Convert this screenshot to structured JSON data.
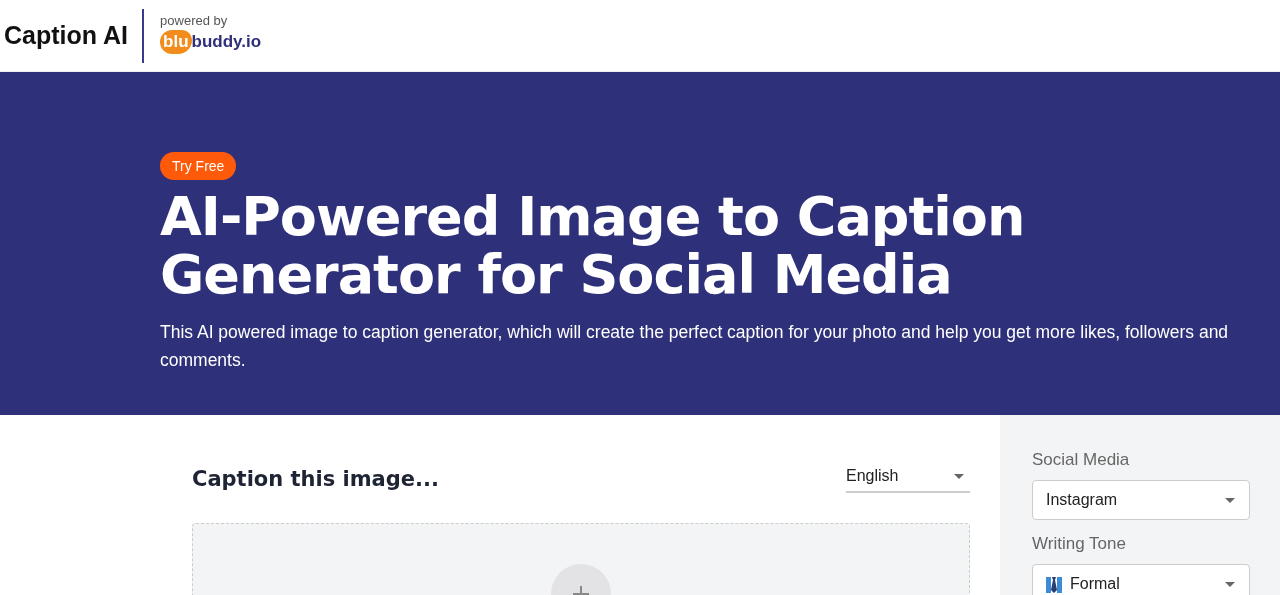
{
  "header": {
    "brand": "Caption AI",
    "powered_by": "powered by",
    "partner_logo": {
      "part_1": "blu",
      "part_2": "buddy.io"
    }
  },
  "hero": {
    "badge": "Try Free",
    "title": "AI-Powered Image to Caption Generator for Social Media",
    "description": "This AI powered image to caption generator, which will create the perfect caption for your photo and help you get more likes, followers and comments."
  },
  "caption_card": {
    "title": "Caption this image...",
    "language": "English"
  },
  "settings": {
    "fields": [
      {
        "label": "Social Media",
        "value": "Instagram",
        "kind": "plain"
      },
      {
        "label": "Writing Tone",
        "value": "Formal",
        "kind": "tie"
      }
    ]
  }
}
